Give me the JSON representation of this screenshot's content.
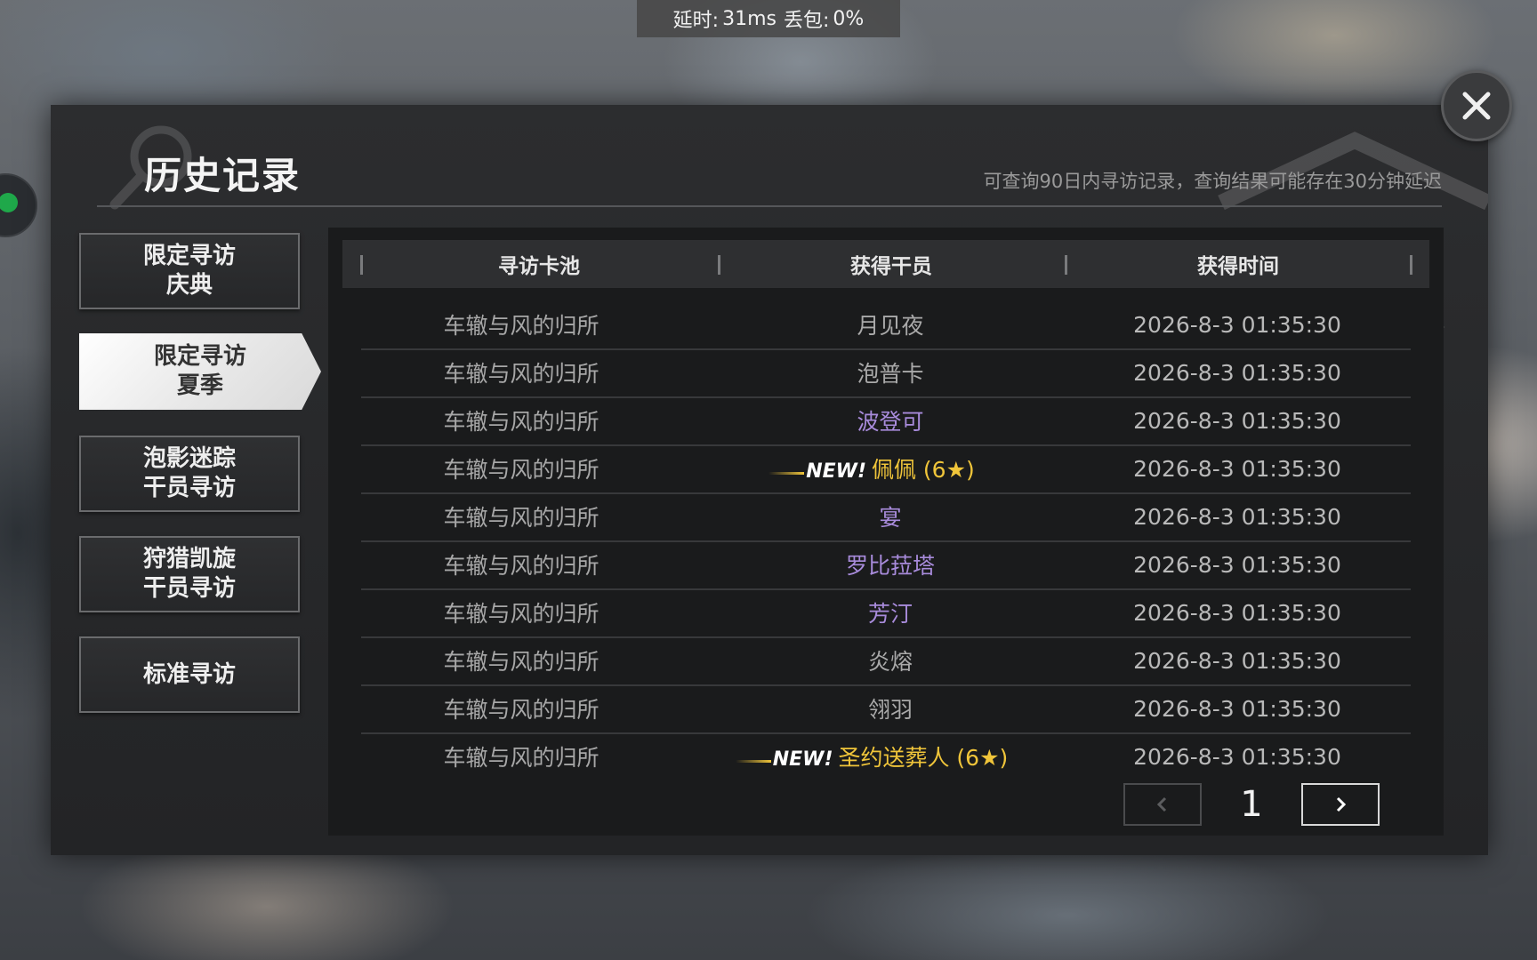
{
  "network_status": {
    "latency_label": "延时:",
    "latency_value": "31ms",
    "loss_label": "丢包:",
    "loss_value": "0%"
  },
  "dialog": {
    "title": "历史记录",
    "hint": "可查询90日内寻访记录，查询结果可能存在30分钟延迟",
    "close_icon": "close-icon"
  },
  "tabs": [
    {
      "label": "限定寻访\n庆典",
      "active": false
    },
    {
      "label": "限定寻访\n夏季",
      "active": true
    },
    {
      "label": "泡影迷踪\n干员寻访",
      "active": false
    },
    {
      "label": "狩猎凯旋\n干员寻访",
      "active": false
    },
    {
      "label": "标准寻访",
      "active": false
    }
  ],
  "table": {
    "columns": [
      "寻访卡池",
      "获得干员",
      "获得时间"
    ],
    "rows": [
      {
        "pool": "车辙与风的归所",
        "operator": "月见夜",
        "time": "2026-8-3 01:35:30",
        "rarity": "normal",
        "new": false
      },
      {
        "pool": "车辙与风的归所",
        "operator": "泡普卡",
        "time": "2026-8-3 01:35:30",
        "rarity": "normal",
        "new": false
      },
      {
        "pool": "车辙与风的归所",
        "operator": "波登可",
        "time": "2026-8-3 01:35:30",
        "rarity": "purple",
        "new": false
      },
      {
        "pool": "车辙与风的归所",
        "operator": "佩佩 (6★)",
        "time": "2026-8-3 01:35:30",
        "rarity": "gold",
        "new": true
      },
      {
        "pool": "车辙与风的归所",
        "operator": "宴",
        "time": "2026-8-3 01:35:30",
        "rarity": "purple",
        "new": false
      },
      {
        "pool": "车辙与风的归所",
        "operator": "罗比菈塔",
        "time": "2026-8-3 01:35:30",
        "rarity": "purple",
        "new": false
      },
      {
        "pool": "车辙与风的归所",
        "operator": "芳汀",
        "time": "2026-8-3 01:35:30",
        "rarity": "purple",
        "new": false
      },
      {
        "pool": "车辙与风的归所",
        "operator": "炎熔",
        "time": "2026-8-3 01:35:30",
        "rarity": "normal",
        "new": false
      },
      {
        "pool": "车辙与风的归所",
        "operator": "翎羽",
        "time": "2026-8-3 01:35:30",
        "rarity": "normal",
        "new": false
      },
      {
        "pool": "车辙与风的归所",
        "operator": "圣约送葬人 (6★)",
        "time": "2026-8-3 01:35:30",
        "rarity": "gold",
        "new": true
      }
    ],
    "new_tag": "NEW!"
  },
  "pagination": {
    "current_page": "1",
    "prev_icon": "chevron-left-icon",
    "next_icon": "chevron-right-icon"
  },
  "colors": {
    "purple_operator": "#a88bdb",
    "gold_operator": "#f0c53a",
    "status_indicator": "#1fa84a"
  }
}
